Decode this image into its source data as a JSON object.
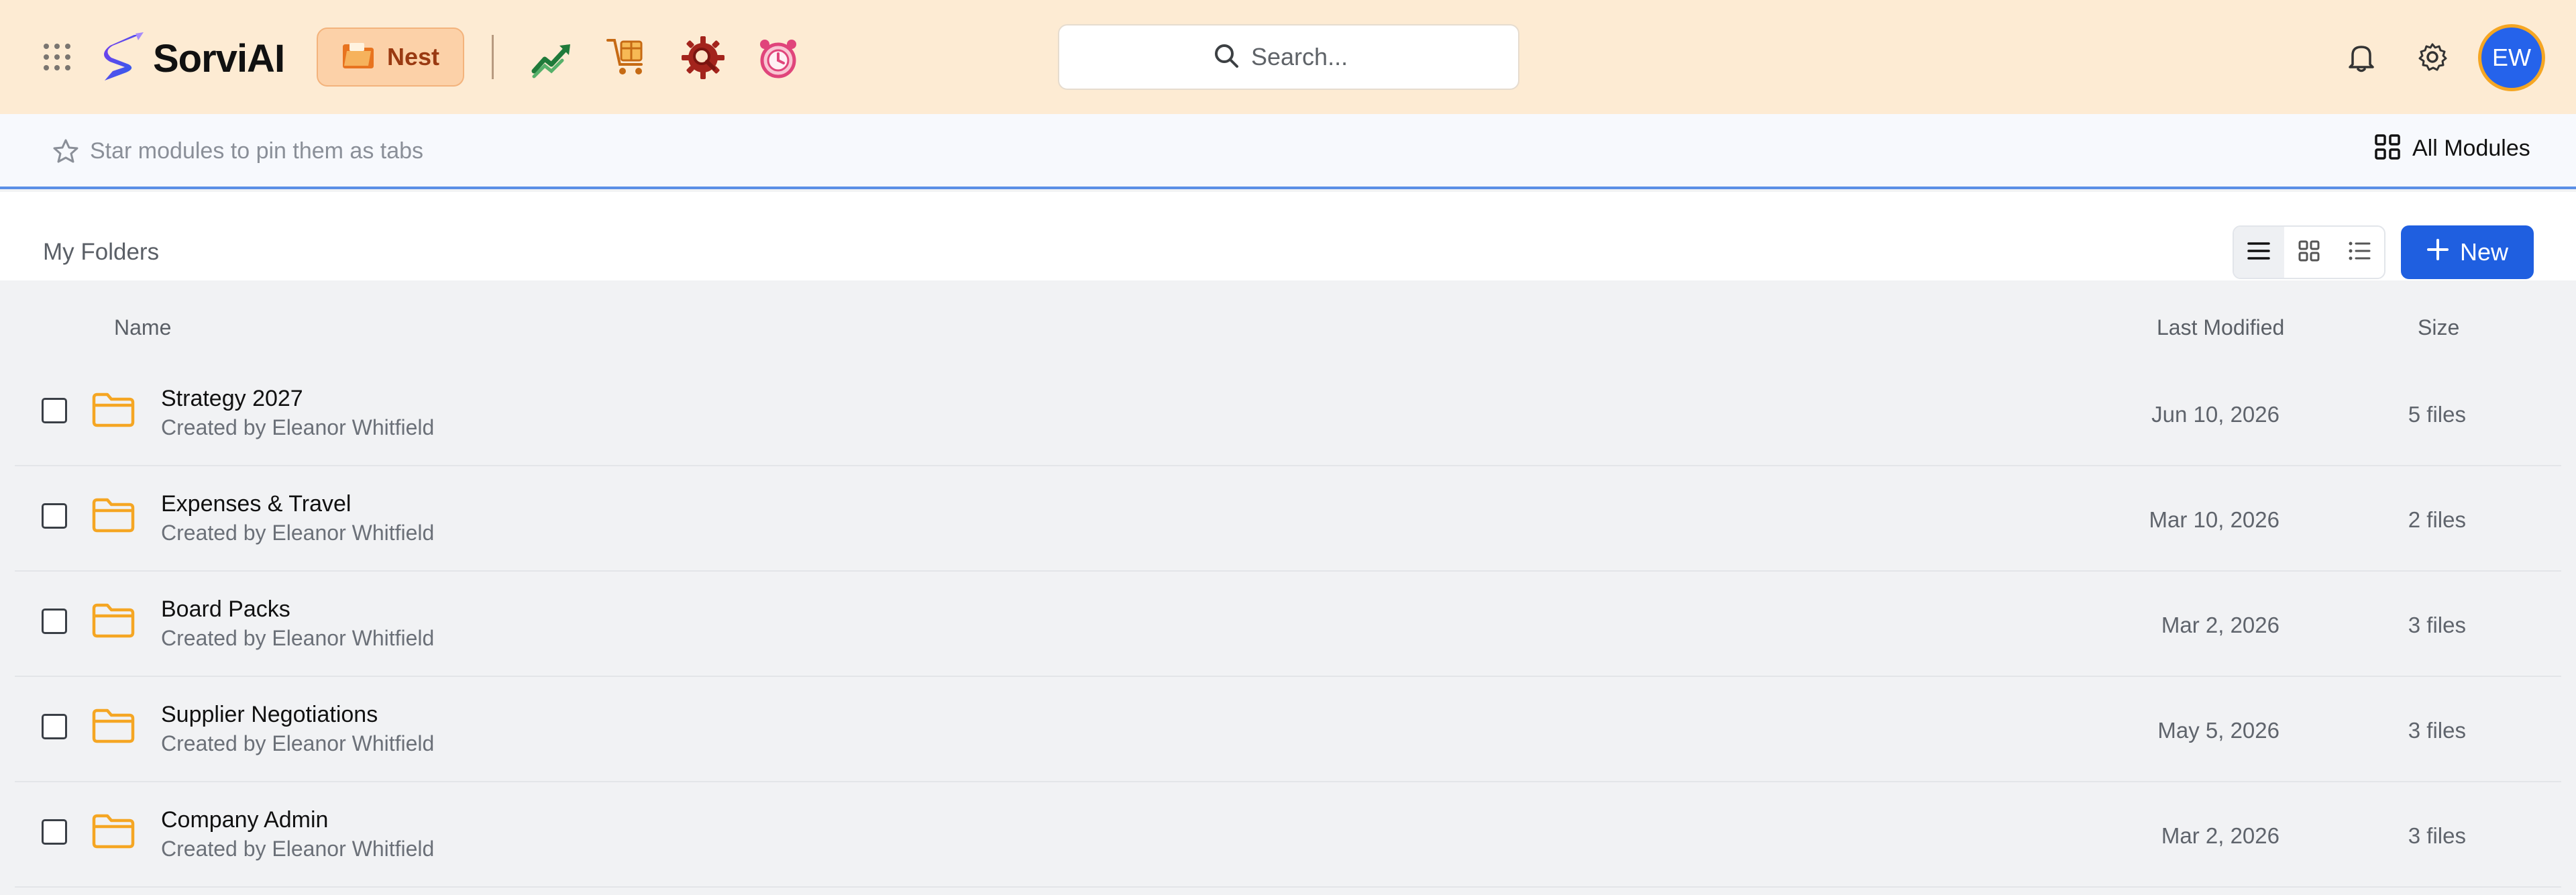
{
  "header": {
    "brand": "SorviAI",
    "active_module": "Nest",
    "module_icons": [
      "growth-chart-icon",
      "package-cart-icon",
      "gear-search-icon",
      "alarm-clock-icon"
    ],
    "search_placeholder": "Search...",
    "avatar_initials": "EW"
  },
  "pinbar": {
    "hint": "Star modules to pin them as tabs",
    "all_modules_label": "All Modules"
  },
  "toolbar": {
    "title": "My Folders",
    "new_label": "New"
  },
  "table": {
    "columns": {
      "name": "Name",
      "modified": "Last Modified",
      "size": "Size"
    },
    "rows": [
      {
        "name": "Strategy 2027",
        "sub": "Created by Eleanor Whitfield",
        "modified": "Jun 10, 2026",
        "size": "5 files"
      },
      {
        "name": "Expenses & Travel",
        "sub": "Created by Eleanor Whitfield",
        "modified": "Mar 10, 2026",
        "size": "2 files"
      },
      {
        "name": "Board Packs",
        "sub": "Created by Eleanor Whitfield",
        "modified": "Mar 2, 2026",
        "size": "3 files"
      },
      {
        "name": "Supplier Negotiations",
        "sub": "Created by Eleanor Whitfield",
        "modified": "May 5, 2026",
        "size": "3 files"
      },
      {
        "name": "Company Admin",
        "sub": "Created by Eleanor Whitfield",
        "modified": "Mar 2, 2026",
        "size": "3 files"
      }
    ]
  },
  "colors": {
    "header_bg": "#fdebd3",
    "accent_blue": "#1f5fe0",
    "folder": "#f5a623"
  }
}
